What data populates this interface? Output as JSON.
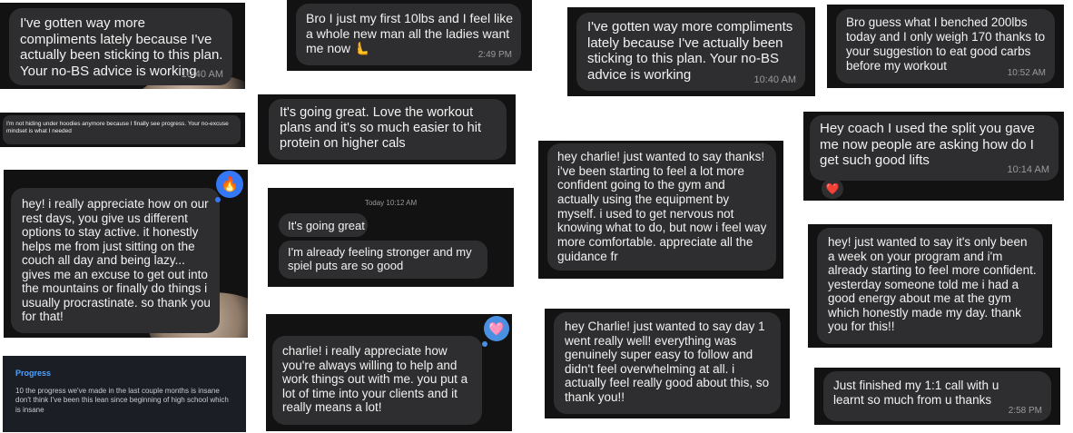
{
  "messages": [
    {
      "text": "I've gotten way more compliments lately because I've actually been sticking to this plan. Your no-BS advice is working",
      "time": "10:40 AM"
    },
    {
      "text": "Bro I just my first 10lbs and I feel like a whole new man all the ladies want me now 🫷",
      "time": "2:49 PM"
    },
    {
      "text": "I've gotten way more compliments lately because I've actually been sticking to this plan. Your no-BS advice is working",
      "time": "10:40 AM"
    },
    {
      "text": "Bro guess what I benched 200lbs today and I only weigh 170 thanks to your suggestion to eat good carbs before my workout",
      "time": "10:52 AM"
    },
    {
      "text": "I'm not hiding under hoodies anymore because I finally see progress. Your no-excuse mindset is what I needed"
    },
    {
      "text": "It's going great. Love the workout plans and it's so much easier to hit protein on higher cals"
    },
    {
      "text": "Hey coach I used the split you gave me now people are asking how do I get such good lifts",
      "time": "10:14 AM",
      "reaction": "❤️"
    },
    {
      "text": "hey charlie! just wanted to say thanks! i've been starting to feel a lot more confident going to the gym and actually using the equipment by myself. i used to get nervous not knowing what to do, but now i feel way more comfortable. appreciate all the guidance fr"
    },
    {
      "text": "hey! i really appreciate how on our rest days, you give us different options to stay active. it honestly helps me from just sitting on the couch all day and being lazy... gives me an excuse to get out into the mountains or finally do things i usually procrastinate. so thank you for that!",
      "reaction": "🔥"
    },
    {
      "header": "Today 10:12 AM",
      "lines": [
        "It's going great",
        "I'm already feeling stronger and my spiel puts are so good"
      ]
    },
    {
      "text": "hey! just wanted to say it's only been a week on your program and i'm already starting to feel more confident. yesterday someone told me i had a good energy about me at the gym which honestly made my day. thank you for this!!"
    },
    {
      "title": "Progress",
      "text": "10 the progress we've made in the last couple months is insane don't think I've been this lean since beginning of high school which is insane"
    },
    {
      "text": "charlie! i really appreciate how you're always willing to help and work things out with me. you put a lot of time into your clients and it really means a lot!",
      "reaction": "🩷"
    },
    {
      "text": "hey Charlie! just wanted to say day 1 went really well! everything was genuinely super easy to follow and didn't feel overwhelming at all. i actually feel really good about this, so thank you!!"
    },
    {
      "text": "Just finished my 1:1 call with u learnt so much from u thanks",
      "time": "2:58 PM"
    }
  ],
  "colors": {
    "card_bg": "#121212",
    "bubble_bg": "#2e2e30",
    "text": "#f2f2f2",
    "timestamp": "#9a9a9e",
    "progress_title": "#4da3ff",
    "fire_reaction_bg": "#3478f6",
    "heart_reaction_bg": "#4a90e2"
  },
  "icons": {
    "fire": "fire-icon",
    "heart": "heart-icon",
    "pink-heart": "pink-heart-icon",
    "point": "pointing-hand-icon"
  }
}
